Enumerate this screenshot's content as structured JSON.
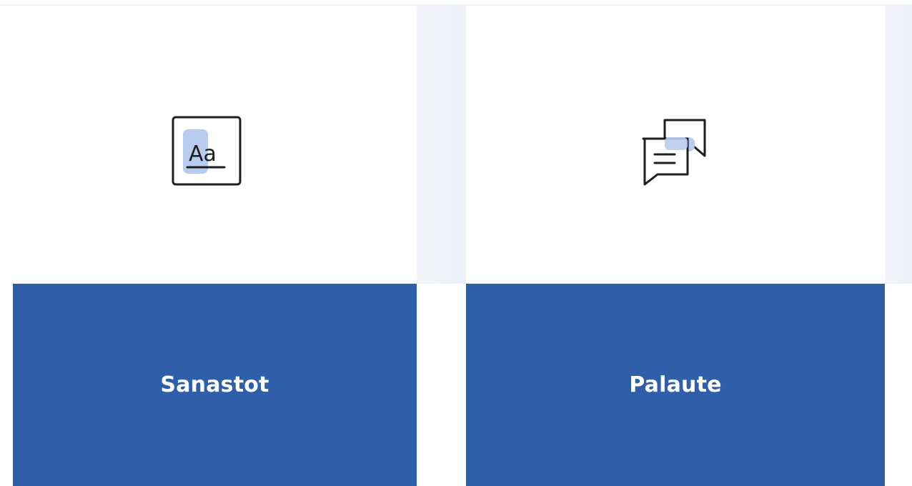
{
  "cards": [
    {
      "label": "Sanastot",
      "icon": "terminology-icon",
      "icon_text": "Aa"
    },
    {
      "label": "Palaute",
      "icon": "feedback-chat-icon"
    }
  ],
  "colors": {
    "card_bottom": "#2f5fa8",
    "icon_highlight": "#b9ccf0",
    "icon_stroke": "#1e1e1e",
    "background_shade": "#eef1f7"
  }
}
